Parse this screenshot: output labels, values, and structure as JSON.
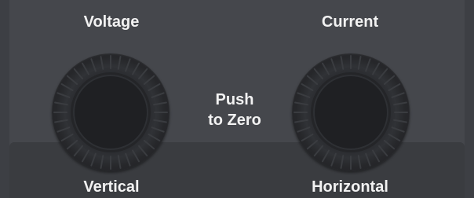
{
  "controls": {
    "voltage_label": "Voltage",
    "current_label": "Current",
    "center_hint_line1": "Push",
    "center_hint_line2": "to Zero",
    "vertical_label": "Vertical",
    "horizontal_label": "Horizontal"
  },
  "colors": {
    "panel": "#45474c",
    "lower_band": "#3a3c40",
    "text": "#f2f2f2",
    "knob_dark": "#1c1d20"
  }
}
